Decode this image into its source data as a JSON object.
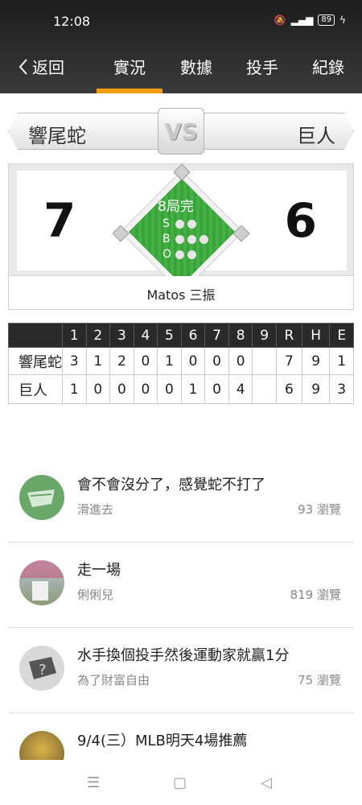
{
  "status": {
    "time": "12:08",
    "battery": "89"
  },
  "nav": {
    "back_label": "返回",
    "tabs": [
      "實況",
      "數據",
      "投手",
      "紀錄"
    ],
    "active_tab": "實況"
  },
  "game": {
    "away_team": "響尾蛇",
    "home_team": "巨人",
    "vs_label": "VS",
    "away_score": "7",
    "home_score": "6",
    "inning_label": "8局完",
    "count_letters": [
      "S",
      "B",
      "O"
    ],
    "play_text": "Matos 三振"
  },
  "linescore": {
    "headers": [
      "",
      "1",
      "2",
      "3",
      "4",
      "5",
      "6",
      "7",
      "8",
      "9",
      "R",
      "H",
      "E"
    ],
    "rows": [
      [
        "響尾蛇",
        "3",
        "1",
        "2",
        "0",
        "1",
        "0",
        "0",
        "0",
        "",
        "7",
        "9",
        "1"
      ],
      [
        "巨人",
        "1",
        "0",
        "0",
        "0",
        "0",
        "1",
        "0",
        "4",
        "",
        "6",
        "9",
        "3"
      ]
    ]
  },
  "posts": [
    {
      "title": "會不會沒分了，感覺蛇不打了",
      "author": "滑進去",
      "views": "93 瀏覽"
    },
    {
      "title": "走一場",
      "author": "俐俐兒",
      "views": "819 瀏覽"
    },
    {
      "title": "水手換個投手然後運動家就贏1分",
      "author": "為了財富自由",
      "views": "75 瀏覽"
    },
    {
      "title": "9/4(三）MLB明天4場推薦",
      "author": "",
      "views": ""
    }
  ],
  "colors": {
    "accent": "#f39c12",
    "field_green": "#3aa33a",
    "header_bg": "#2a2a2a"
  }
}
